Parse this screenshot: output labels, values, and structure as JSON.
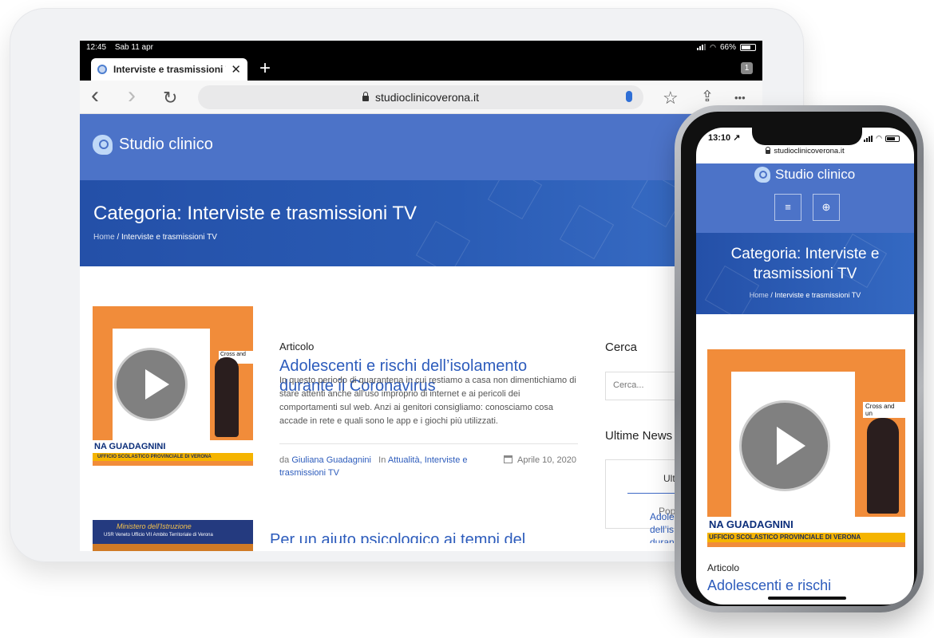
{
  "tablet": {
    "status": {
      "time": "12:45",
      "date": "Sab 11 apr",
      "battery": "66%"
    },
    "tab": {
      "title": "Interviste e trasmissioni TV",
      "close": "✕",
      "new_tab": "+",
      "count": "1"
    },
    "nav": {
      "back": "‹",
      "forward": "›",
      "reload": "↻",
      "url": "studioclinicoverona.it",
      "bookmark": "☆",
      "share": "⇪",
      "more": "•••"
    },
    "site": {
      "logo_text": "Studio clinico",
      "page_title": "Categoria: Interviste e trasmissioni TV",
      "breadcrumb": {
        "home": "Home",
        "sep": " / ",
        "current": "Interviste e trasmissioni TV"
      }
    },
    "posts": [
      {
        "type": "Articolo",
        "title": "Adolescenti e rischi dell’isolamento durante il Coronavirus",
        "excerpt": "In questo periodo di quarantena in cui restiamo a casa non dimentichiamo di stare attenti anche all’uso improprio di internet e ai pericoli dei comportamenti sul web. Anzi ai genitori consigliamo: conosciamo cosa accade in rete e quali sono le app e i giochi più utilizzati.",
        "by": "da",
        "author": "Giuliana Guadagnini",
        "in": "In",
        "category_1": "Attualità",
        "category_2": "Interviste e trasmissioni TV",
        "date": "Aprile 10, 2020",
        "thumb_band": "NA GUADAGNINI",
        "thumb_sub": "UFFICIO SCOLASTICO PROVINCIALE DI VERONA",
        "thumb_caption": "Cross and un"
      },
      {
        "type": "Articolo",
        "title": "Per un aiuto psicologico ai tempi del",
        "thumb_banner": "Ministero dell'Istruzione",
        "thumb_sub": "USR Veneto Ufficio VII Ambito Territoriale di Verona"
      }
    ],
    "sidebar": {
      "search_heading": "Cerca",
      "search_placeholder": "Cerca...",
      "news_heading": "Ultime News",
      "tab_latest": "Ultim",
      "tab_popular": "Popol",
      "news_item_lines": [
        "Adole",
        "dell’is",
        "duran"
      ]
    }
  },
  "phone": {
    "status": {
      "time": "13:10 ↗"
    },
    "url": "studioclinicoverona.it",
    "logo_text": "Studio clinico",
    "menu_icon": "≡",
    "search_icon": "⊕",
    "page_title": "Categoria: Interviste e trasmissioni TV",
    "breadcrumb": {
      "home": "Home",
      "sep": " / ",
      "current": "Interviste e trasmissioni TV"
    },
    "post": {
      "type": "Articolo",
      "title": "Adolescenti e rischi",
      "thumb_band": "NA GUADAGNINI",
      "thumb_sub": "UFFICIO SCOLASTICO PROVINCIALE DI VERONA",
      "thumb_caption": "Cross and un"
    }
  },
  "colors": {
    "brand_blue": "#4c73c8",
    "hero_blue": "#2a5cb5",
    "link_blue": "#2d5cbc",
    "thumb_orange": "#f18c3a"
  }
}
